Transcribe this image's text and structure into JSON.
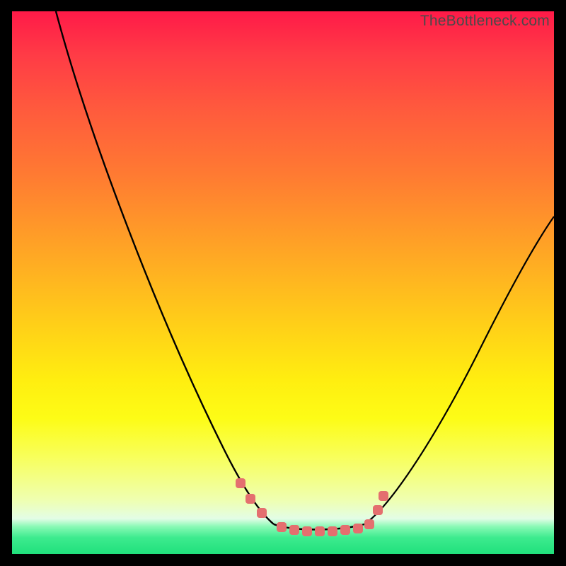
{
  "watermark": "TheBottleneck.com",
  "chart_data": {
    "type": "line",
    "title": "",
    "xlabel": "",
    "ylabel": "",
    "xlim": [
      0,
      100
    ],
    "ylim": [
      0,
      100
    ],
    "grid": false,
    "legend": false,
    "gradient_stops_pct_from_top": [
      {
        "pct": 0,
        "color": "#ff1a48"
      },
      {
        "pct": 8,
        "color": "#ff3b46"
      },
      {
        "pct": 18,
        "color": "#ff5a3d"
      },
      {
        "pct": 30,
        "color": "#ff7a32"
      },
      {
        "pct": 45,
        "color": "#ffa824"
      },
      {
        "pct": 58,
        "color": "#ffd018"
      },
      {
        "pct": 68,
        "color": "#ffee10"
      },
      {
        "pct": 75,
        "color": "#fdfc16"
      },
      {
        "pct": 82,
        "color": "#f8ff5a"
      },
      {
        "pct": 90,
        "color": "#efffb0"
      },
      {
        "pct": 93.5,
        "color": "#e3fde6"
      },
      {
        "pct": 95,
        "color": "#87f9b4"
      },
      {
        "pct": 97,
        "color": "#3deb8e"
      },
      {
        "pct": 100,
        "color": "#20e07c"
      }
    ],
    "series": [
      {
        "name": "bottleneck-curve",
        "color": "#000000",
        "x": [
          8,
          12,
          16,
          20,
          24,
          28,
          32,
          36,
          40,
          42,
          44,
          46,
          48,
          50,
          52,
          54,
          56,
          58,
          60,
          62,
          64,
          68,
          72,
          76,
          80,
          84,
          88,
          92,
          96,
          100
        ],
        "y": [
          100,
          92,
          84,
          76,
          68,
          60,
          52,
          44,
          35,
          30,
          24,
          17,
          10,
          6,
          5,
          5,
          5,
          5,
          5,
          5,
          5,
          8,
          12,
          18,
          24,
          30,
          37,
          45,
          53,
          62
        ]
      }
    ],
    "markers": {
      "name": "highlight-points",
      "color": "#e46f6f",
      "shape": "rounded-square",
      "x": [
        42,
        44,
        46,
        50,
        52,
        54,
        56,
        58,
        60,
        62,
        64,
        65.5,
        66.5
      ],
      "y": [
        13,
        10,
        7,
        5,
        5,
        5,
        5,
        5,
        5,
        5,
        5,
        8,
        11
      ]
    }
  }
}
